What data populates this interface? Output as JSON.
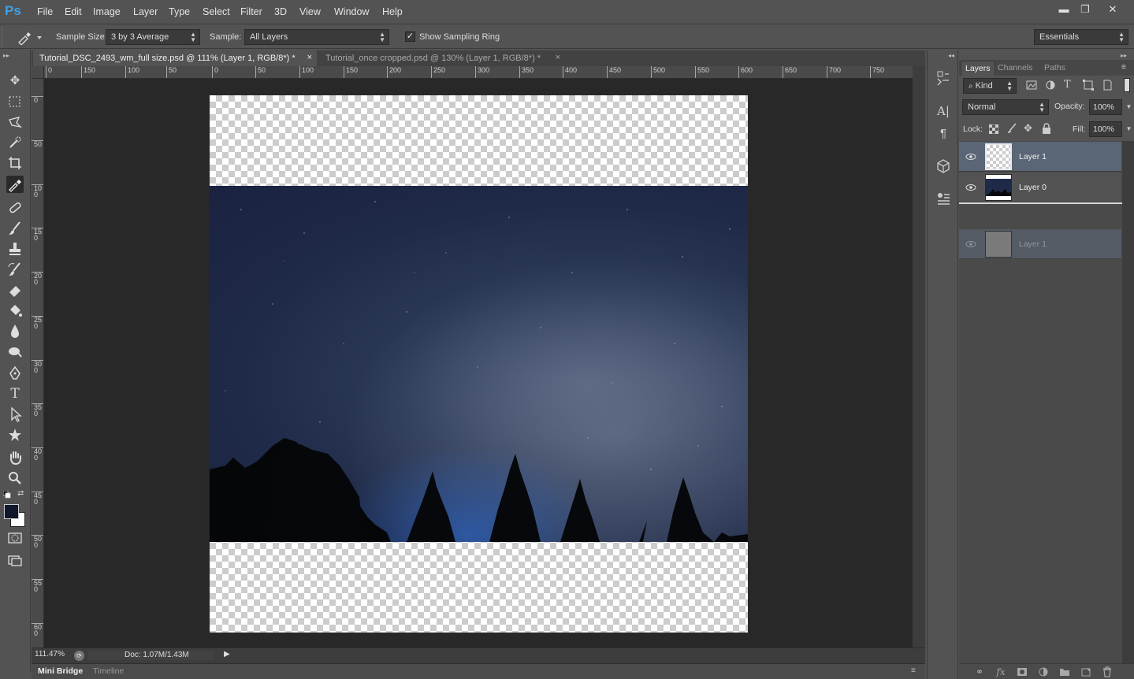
{
  "app": {
    "logo": "Ps"
  },
  "menu": [
    "File",
    "Edit",
    "Image",
    "Layer",
    "Type",
    "Select",
    "Filter",
    "3D",
    "View",
    "Window",
    "Help"
  ],
  "window_controls": {
    "minimize": "▬",
    "restore": "❐",
    "close": "✕"
  },
  "options_bar": {
    "sample_size_label": "Sample Size:",
    "sample_size_value": "3 by 3 Average",
    "sample_label": "Sample:",
    "sample_value": "All Layers",
    "show_sampling_ring_label": "Show Sampling Ring",
    "show_sampling_ring_checked": true,
    "workspace": "Essentials"
  },
  "tools": [
    "move",
    "marquee",
    "lasso",
    "quick-selection",
    "crop",
    "eyedropper",
    "spot-healing",
    "brush",
    "clone-stamp",
    "history-brush",
    "eraser",
    "paint-bucket",
    "blur",
    "dodge",
    "pen",
    "type",
    "path-selection",
    "custom-shape",
    "hand",
    "zoom"
  ],
  "active_tool": "eyedropper",
  "colors": {
    "foreground": "#10182b",
    "background": "#ffffff",
    "accent": "#3fa0e6",
    "selected_layer": "#5a6575"
  },
  "document_tabs": [
    {
      "title": "Tutorial_DSC_2493_wm_full size.psd @ 111% (Layer 1, RGB/8*) *",
      "close": "×",
      "active": true
    },
    {
      "title": "Tutorial_once cropped.psd @ 130% (Layer 1, RGB/8*) *",
      "close": "×",
      "active": false
    }
  ],
  "ruler": {
    "h_labels": [
      "0",
      "150",
      "100",
      "50",
      "0",
      "50",
      "100",
      "150",
      "200",
      "250",
      "300",
      "350",
      "400",
      "450",
      "500",
      "550",
      "600",
      "650",
      "700",
      "750"
    ],
    "v_labels": [
      "0",
      "50",
      "100",
      "150",
      "200",
      "250",
      "300",
      "350",
      "400",
      "450",
      "500",
      "550",
      "600"
    ]
  },
  "status": {
    "zoom": "111.47%",
    "doc_size": "Doc: 1.07M/1.43M"
  },
  "bottom_tabs": [
    "Mini Bridge",
    "Timeline"
  ],
  "layers_panel": {
    "tabs": [
      "Layers",
      "Channels",
      "Paths"
    ],
    "filter_kind": "Kind",
    "blend_mode": "Normal",
    "opacity_label": "Opacity:",
    "opacity_value": "100%",
    "lock_label": "Lock:",
    "fill_label": "Fill:",
    "fill_value": "100%",
    "layers": [
      {
        "name": "Layer 1",
        "selected": true,
        "thumb": "transparent"
      },
      {
        "name": "Layer 0",
        "selected": false,
        "thumb": "night-sky"
      }
    ],
    "drag_ghost": {
      "name": "Layer 1"
    },
    "footer_icons": [
      "link-icon",
      "fx-icon",
      "mask-icon",
      "adjustment-icon",
      "folder-icon",
      "new-layer-icon",
      "trash-icon"
    ]
  }
}
